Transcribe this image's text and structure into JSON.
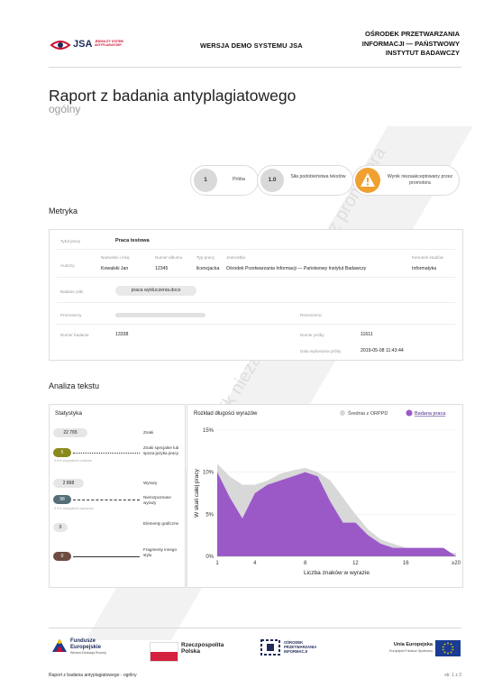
{
  "header": {
    "logo_text": "JSA",
    "logo_sub": "JEDNOLITY SYSTEM ANTYPLAGIATOWY",
    "center_text": "WERSJA DEMO SYSTEMU JSA",
    "right_text": "OŚRODEK PRZETWARZANIA\nINFORMACJI — PAŃSTWOWY\nINSTYTUT BADAWCZY"
  },
  "report": {
    "title": "Raport z badania antyplagiatowego",
    "subtitle": "ogólny"
  },
  "summary": {
    "proba_value": "1",
    "proba_label": "Próba",
    "similarity_value": "1.0",
    "similarity_label": "Siła podobieństwa tekstów",
    "result_label": "Wynik niezaakceptowany przez promotora",
    "result_icon": "warning-icon",
    "result_color": "#f0a030"
  },
  "watermark_text": "Wynik niezaakceptowany przez promotora",
  "metryka": {
    "heading": "Metryka",
    "typ_pracy_label": "Tytuł pracy",
    "typ_pracy_value": "Praca testowa",
    "autorzy_label": "Autorzy",
    "col_nazwisko": "Nazwisko i imię",
    "col_album": "Numer albumu",
    "col_typ": "Typ pracy",
    "col_jednostka": "Jednostka",
    "col_kierunek": "Kierunek studiów",
    "nazwisko": "Kowalski Jan",
    "album": "12345",
    "typ": "licencjacka",
    "jednostka": "Ośrodek Przetwarzania Informacji — Państwowy Instytut Badawczy",
    "kierunek": "Informatyka",
    "badane_pliki_label": "Badane pliki",
    "plik": "praca wykluczenia.docx",
    "promotorzy_label": "Promotorzy",
    "recenzenci_label": "Recenzenci",
    "numer_badania_label": "Numer badania",
    "numer_badania": "13338",
    "numer_proby_label": "Numer próby",
    "numer_proby": "11611",
    "data_label": "Data wykonania próby",
    "data": "2019-05-08 11:43:44"
  },
  "analiza": {
    "heading": "Analiza tekstu",
    "statystyka_title": "Statystyka",
    "stats": [
      {
        "value": "22 765",
        "label": "Znaki"
      },
      {
        "value": "5",
        "label": "Znaki specjalne lub spoza języka pracy",
        "note": "0.0% wszystkich znaków"
      },
      {
        "value": "2 898",
        "label": "Wyrazy"
      },
      {
        "value": "98",
        "label": "Nierozpoznane wyrazy",
        "note": "3.0% wszystkich wyrazów"
      },
      {
        "value": "0",
        "label": "Elementy graficzne"
      },
      {
        "value": "0",
        "label": "Fragmenty innego stylu"
      }
    ],
    "colors": {
      "olive": "#8a8a1a",
      "slate": "#546e7a",
      "brown": "#6d4c41",
      "purple": "#9b59c8",
      "grey_area": "#d8d8d8"
    }
  },
  "chart_data": {
    "type": "area",
    "title": "Rozkład długości wyrazów",
    "xlabel": "Liczba znaków w wyrazie",
    "ylabel": "W skali całej pracy",
    "x_ticks": [
      "1",
      "4",
      "8",
      "12",
      "16",
      "≥20"
    ],
    "y_ticks": [
      "0%",
      "5%",
      "10%",
      "15%"
    ],
    "ylim": [
      0,
      15
    ],
    "xlim": [
      1,
      20
    ],
    "legend": [
      "Średnia z ORPPD",
      "Badana praca"
    ],
    "legend_position": "top-right",
    "series": [
      {
        "name": "Średnia z ORPPD",
        "x": [
          1,
          2,
          3,
          4,
          5,
          6,
          7,
          8,
          9,
          10,
          11,
          12,
          13,
          14,
          15,
          16,
          17,
          18,
          19,
          20
        ],
        "values": [
          11.0,
          9.5,
          8.5,
          8.5,
          9.0,
          9.8,
          10.2,
          10.5,
          10.0,
          9.0,
          7.0,
          5.0,
          3.2,
          2.0,
          1.5,
          1.0,
          0.8,
          0.6,
          0.5,
          0.4
        ]
      },
      {
        "name": "Badana praca",
        "x": [
          1,
          2,
          3,
          4,
          5,
          6,
          7,
          8,
          9,
          10,
          11,
          12,
          13,
          14,
          15,
          16,
          17,
          18,
          19,
          20
        ],
        "values": [
          10.0,
          7.0,
          4.5,
          7.5,
          8.5,
          9.0,
          9.5,
          10.0,
          9.5,
          6.5,
          4.0,
          4.0,
          2.5,
          1.5,
          1.0,
          1.0,
          1.0,
          1.0,
          1.0,
          0.0
        ]
      }
    ]
  },
  "footer": {
    "fundusze": "Fundusze Europejskie",
    "fundusze_sub": "Wiedza Edukacja Rozwój",
    "rp": "Rzeczpospolita Polska",
    "opi": "OŚRODEK PRZETWARZANIA INFORMACJI",
    "ue": "Unia Europejska",
    "ue_sub": "Europejski Fundusz Społeczny",
    "bottom_left": "Raport z badania antyplagiatowego - ogólny",
    "page": "str. 1 z 2"
  }
}
